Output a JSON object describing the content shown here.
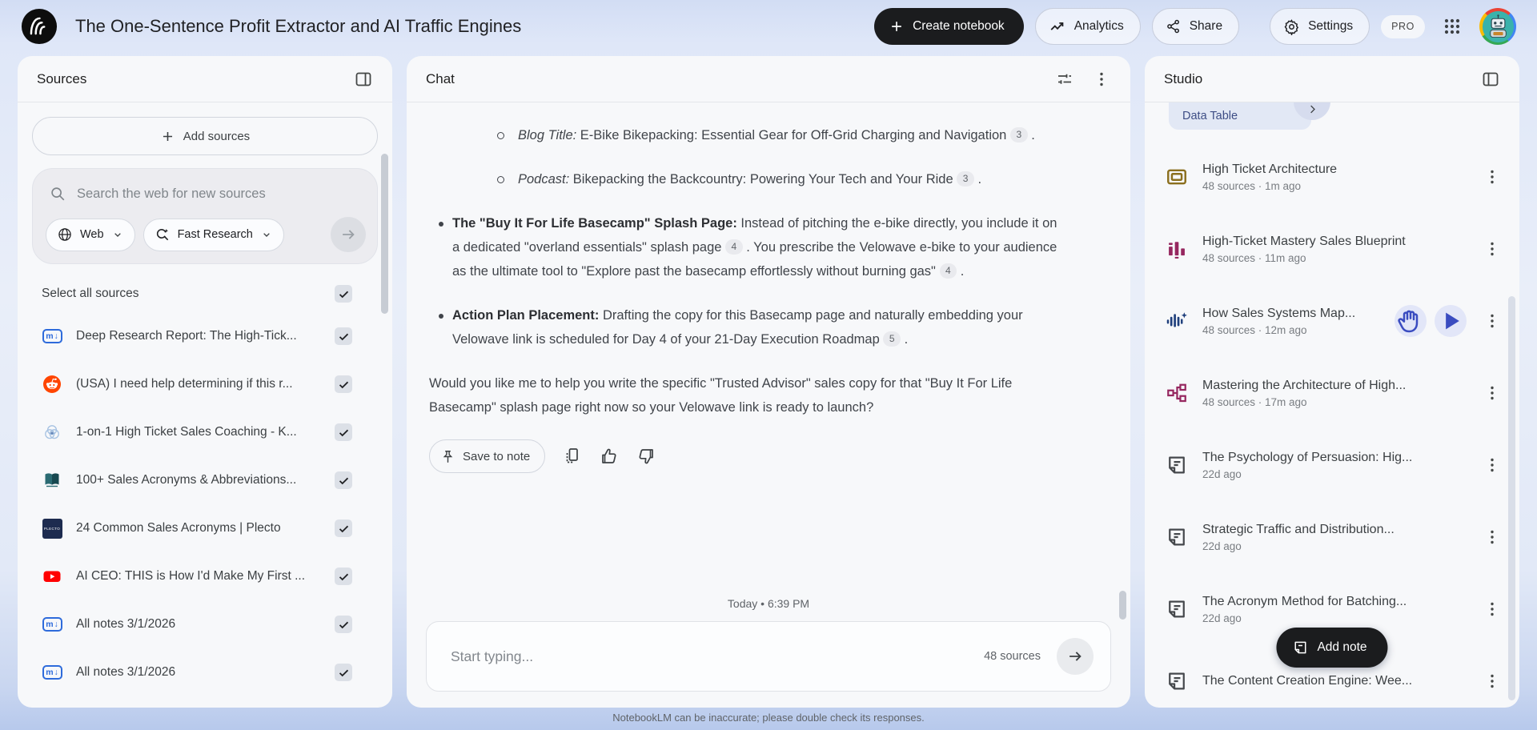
{
  "header": {
    "title": "The One-Sentence Profit Extractor and AI Traffic Engines",
    "create_notebook_label": "Create notebook",
    "analytics_label": "Analytics",
    "share_label": "Share",
    "settings_label": "Settings",
    "pro_badge": "PRO"
  },
  "sources": {
    "title": "Sources",
    "add_sources_label": "Add sources",
    "search_placeholder": "Search the web for new sources",
    "web_chip_label": "Web",
    "research_chip_label": "Fast Research",
    "select_all_label": "Select all sources",
    "items": [
      {
        "title": "Deep Research Report: The High-Tick...",
        "icon": "note",
        "checked": true
      },
      {
        "title": "(USA) I need help determining if this r...",
        "icon": "reddit",
        "checked": true
      },
      {
        "title": "1-on-1 High Ticket Sales Coaching - K...",
        "icon": "web",
        "checked": true
      },
      {
        "title": "100+ Sales Acronyms & Abbreviations...",
        "icon": "book",
        "checked": true
      },
      {
        "title": "24 Common Sales Acronyms | Plecto",
        "icon": "plecto",
        "checked": true
      },
      {
        "title": "AI CEO: THIS is How I'd Make My First ...",
        "icon": "youtube",
        "checked": true
      },
      {
        "title": "All notes 3/1/2026",
        "icon": "note",
        "checked": true
      },
      {
        "title": "All notes 3/1/2026",
        "icon": "note",
        "checked": true
      }
    ]
  },
  "chat": {
    "title": "Chat",
    "blocks": [
      {
        "marker": "circle",
        "segments": [
          {
            "t": "Blog Title:",
            "s": "i"
          },
          {
            "t": " E-Bike Bikepacking: Essential Gear for Off-Grid Charging and Navigation "
          },
          {
            "c": "3"
          },
          {
            "t": " ."
          }
        ]
      },
      {
        "marker": "circle",
        "segments": [
          {
            "t": "Podcast:",
            "s": "i"
          },
          {
            "t": " Bikepacking the Backcountry: Powering Your Tech and Your Ride "
          },
          {
            "c": "3"
          },
          {
            "t": " ."
          }
        ]
      },
      {
        "marker": "disc",
        "segments": [
          {
            "t": "The \"Buy It For Life Basecamp\" Splash Page:",
            "s": "b"
          },
          {
            "t": " Instead of pitching the e-bike directly, you include it on a dedicated \"overland essentials\" splash page "
          },
          {
            "c": "4"
          },
          {
            "t": " . You prescribe the Velowave e-bike to your audience as the ultimate tool to \"Explore past the basecamp effortlessly without burning gas\" "
          },
          {
            "c": "4"
          },
          {
            "t": " ."
          }
        ]
      },
      {
        "marker": "disc",
        "segments": [
          {
            "t": "Action Plan Placement:",
            "s": "b"
          },
          {
            "t": " Drafting the copy for this Basecamp page and naturally embedding your Velowave link is scheduled for Day 4 of your 21-Day Execution Roadmap "
          },
          {
            "c": "5"
          },
          {
            "t": " ."
          }
        ]
      },
      {
        "marker": "none",
        "segments": [
          {
            "t": "Would you like me to help you write the specific \"Trusted Advisor\" sales copy for that \"Buy It For Life Basecamp\" splash page right now so your Velowave link is ready to launch?"
          }
        ]
      }
    ],
    "save_to_note_label": "Save to note",
    "timestamp": "Today • 6:39 PM",
    "input_placeholder": "Start typing...",
    "source_count": "48 sources",
    "disclaimer": "NotebookLM can be inaccurate; please double check its responses."
  },
  "studio": {
    "title": "Studio",
    "data_table_chip_label": "Data Table",
    "items": [
      {
        "title": "High Ticket Architecture",
        "meta": "48 sources · 1m ago",
        "icon": "deck",
        "actions": false
      },
      {
        "title": "High-Ticket Mastery Sales Blueprint",
        "meta": "48 sources · 11m ago",
        "icon": "barchart",
        "actions": false
      },
      {
        "title": "How Sales Systems Map...",
        "meta": "48 sources · 12m ago",
        "icon": "audio",
        "actions": true
      },
      {
        "title": "Mastering the Architecture of High...",
        "meta": "48 sources · 17m ago",
        "icon": "mindmap",
        "actions": false
      },
      {
        "title": "The Psychology of Persuasion: Hig...",
        "meta": "22d ago",
        "icon": "report",
        "actions": false
      },
      {
        "title": "Strategic Traffic and Distribution...",
        "meta": "22d ago",
        "icon": "report",
        "actions": false
      },
      {
        "title": "The Acronym Method for Batching...",
        "meta": "22d ago",
        "icon": "report",
        "actions": false
      },
      {
        "title": "The Content Creation Engine: Wee...",
        "meta": "",
        "icon": "report",
        "actions": false
      }
    ],
    "add_note_label": "Add note"
  }
}
